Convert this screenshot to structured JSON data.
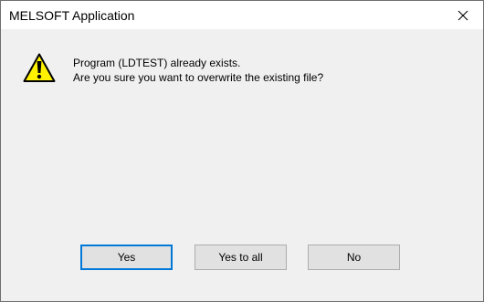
{
  "window": {
    "title": "MELSOFT Application"
  },
  "icons": {
    "warning": "warning-icon",
    "close": "close-icon"
  },
  "message": {
    "line1": "Program (LDTEST) already exists.",
    "line2": "Are you sure you want to overwrite the existing file?"
  },
  "buttons": {
    "yes_label": "Yes",
    "yes_to_all_label": "Yes to all",
    "no_label": "No"
  },
  "colors": {
    "warning_fill": "#fff200",
    "focus_border": "#0078d7"
  }
}
